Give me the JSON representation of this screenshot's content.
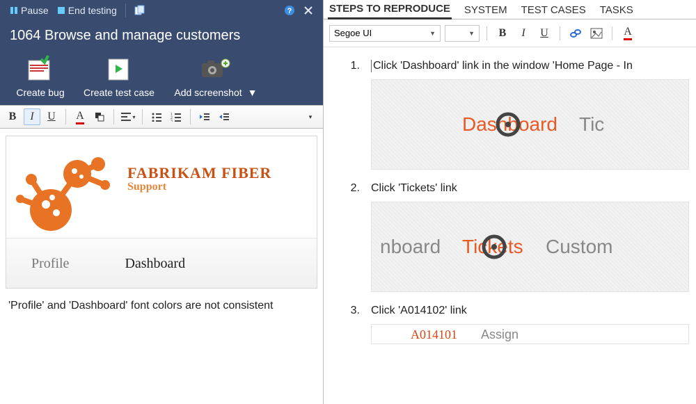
{
  "titlebar": {
    "pause": "Pause",
    "end": "End testing"
  },
  "window_title": "1064 Browse and manage customers",
  "ribbon": {
    "create_bug": "Create bug",
    "create_tc": "Create test case",
    "add_ss": "Add screenshot"
  },
  "brand": {
    "line1": "FABRIKAM FIBER",
    "line2": "Support"
  },
  "nav": {
    "profile": "Profile",
    "dashboard": "Dashboard"
  },
  "note_text": "'Profile' and 'Dashboard' font colors are not consistent",
  "tabs": {
    "steps": "STEPS TO REPRODUCE",
    "system": "SYSTEM",
    "tc": "TEST CASES",
    "tasks": "TASKS"
  },
  "font_name": "Segoe UI",
  "steps": {
    "s1_num": "1.",
    "s1_text": "Click 'Dashboard' link in the window 'Home Page - In",
    "s1_word1": "Dashboard",
    "s1_word2": "Tic",
    "s2_num": "2.",
    "s2_text": "Click 'Tickets' link",
    "s2_word1": "nboard",
    "s2_word2": "Tickets",
    "s2_word3": "Custom",
    "s3_num": "3.",
    "s3_text": "Click 'A014102' link",
    "s3_id": "A014101",
    "s3_assign": "Assign"
  }
}
